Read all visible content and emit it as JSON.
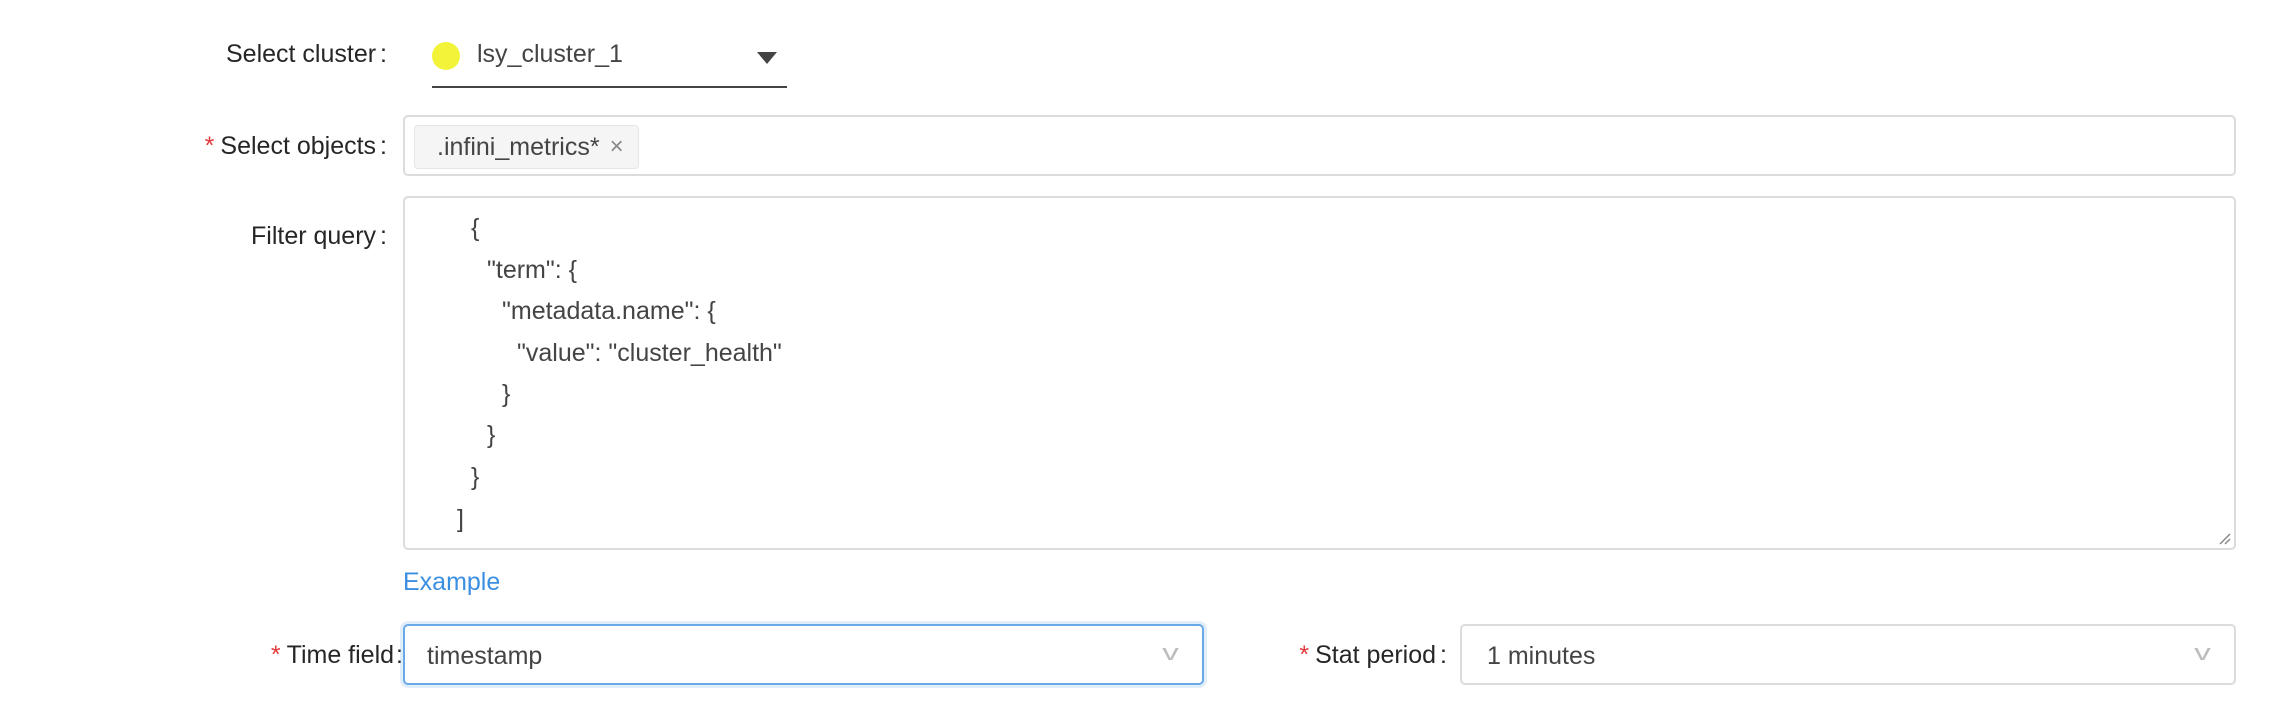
{
  "cluster": {
    "label": "Select cluster",
    "colon": ":",
    "value": "lsy_cluster_1",
    "status_color": "#f3f33a"
  },
  "objects": {
    "label": "Select objects",
    "colon": ":",
    "required_mark": "*",
    "tags": [
      ".infini_metrics*"
    ],
    "remove_glyph": "×"
  },
  "filter": {
    "label": "Filter query",
    "colon": ":",
    "lines": [
      "{",
      "\"term\": {",
      "\"metadata.name\": {",
      "\"value\": \"cluster_health\"",
      "}",
      "}",
      "}",
      "]"
    ]
  },
  "example_link": "Example",
  "time_field": {
    "label": "Time field",
    "colon": ":",
    "required_mark": "*",
    "value": "timestamp"
  },
  "stat_period": {
    "label": "Stat period",
    "colon": ":",
    "required_mark": "*",
    "value": "1 minutes"
  },
  "colors": {
    "link": "#3b8fe0",
    "focus_border": "#6aa9e8",
    "required": "#e4393c"
  }
}
